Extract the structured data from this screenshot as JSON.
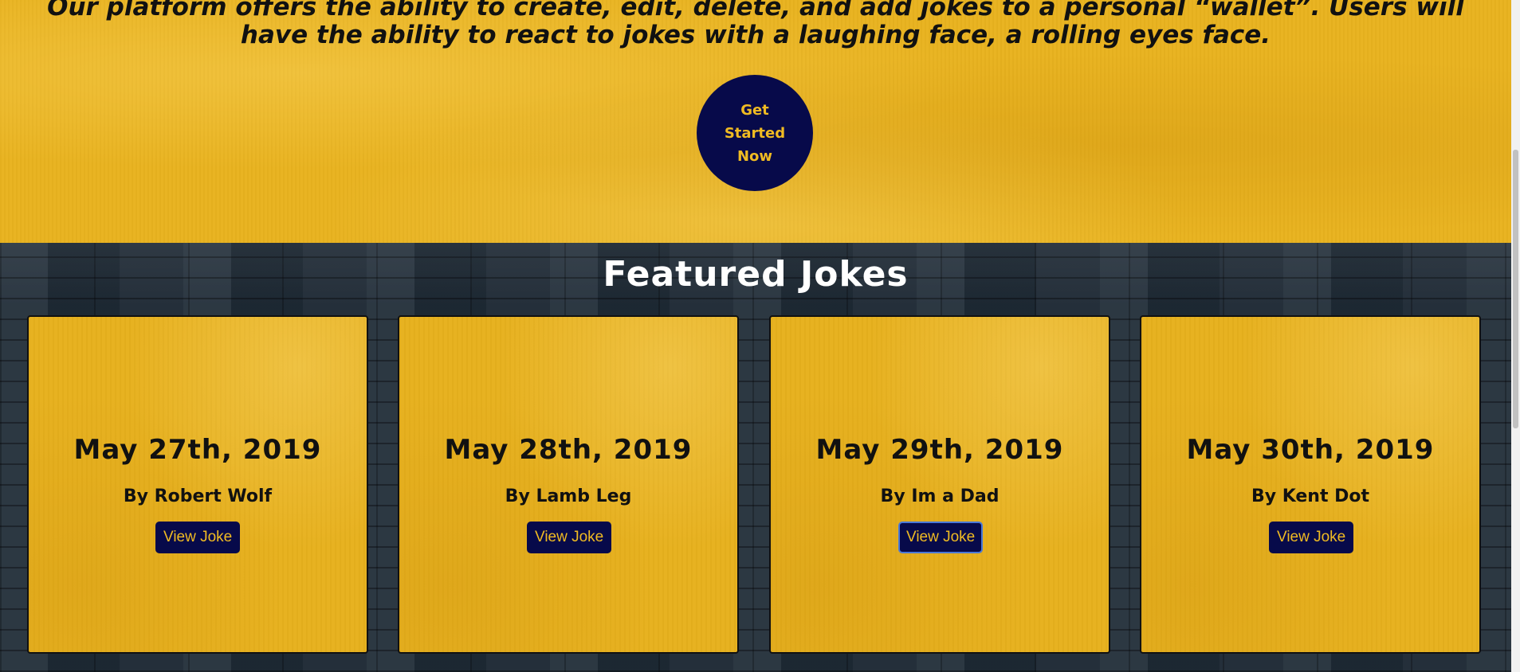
{
  "hero": {
    "description": "Our platform offers the ability to create, edit, delete, and add jokes to a personal “wallet”. Users will have the ability to react to jokes with a laughing face, a rolling eyes face.",
    "cta_label": "Get Started Now"
  },
  "featured": {
    "title": "Featured Jokes",
    "cards": [
      {
        "date": "May 27th, 2019",
        "author": "By Robert Wolf",
        "button_label": "View Joke"
      },
      {
        "date": "May 28th, 2019",
        "author": "By Lamb Leg",
        "button_label": "View Joke"
      },
      {
        "date": "May 29th, 2019",
        "author": "By Im a Dad",
        "button_label": "View Joke"
      },
      {
        "date": "May 30th, 2019",
        "author": "By Kent Dot",
        "button_label": "View Joke"
      }
    ]
  },
  "colors": {
    "hero_yellow": "#e9b31f",
    "navy": "#070a4a",
    "button_text_gold": "#f0bb22",
    "featured_dark": "#1b2630",
    "focus_ring": "#4a78d8"
  }
}
